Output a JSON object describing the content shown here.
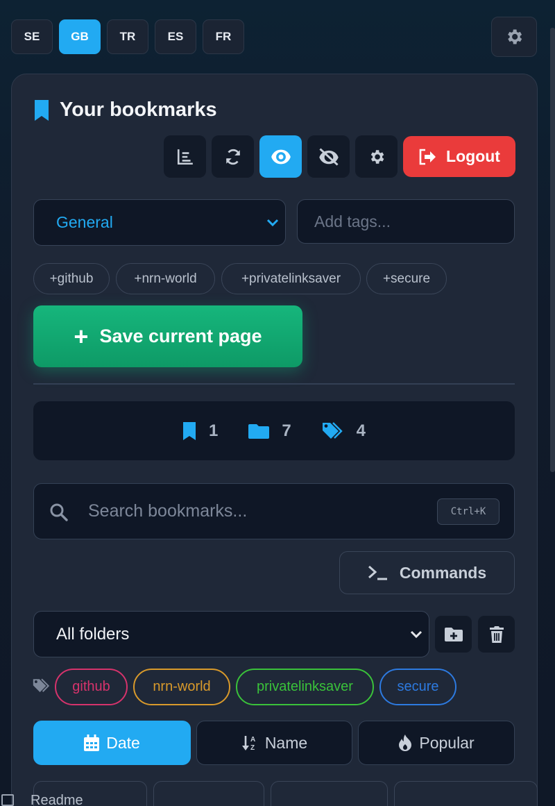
{
  "languages": [
    {
      "code": "SE",
      "active": false
    },
    {
      "code": "GB",
      "active": true
    },
    {
      "code": "TR",
      "active": false
    },
    {
      "code": "ES",
      "active": false
    },
    {
      "code": "FR",
      "active": false
    }
  ],
  "header": {
    "title": "Your bookmarks",
    "logout_label": "Logout",
    "icons": [
      "chart-icon",
      "sync-icon",
      "eye-icon",
      "eye-slash-icon",
      "gear-icon"
    ]
  },
  "form": {
    "folder_selected": "General",
    "tags_placeholder": "Add tags...",
    "quick_tags": [
      "+github",
      "+nrn-world",
      "+privatelinksaver",
      "+secure"
    ],
    "save_label": "Save current page"
  },
  "stats": {
    "bookmarks": "1",
    "folders": "7",
    "tags": "4"
  },
  "search": {
    "placeholder": "Search bookmarks...",
    "shortcut": "Ctrl+K"
  },
  "commands_label": "Commands",
  "filter": {
    "folder_selected": "All folders",
    "tags": [
      {
        "label": "github",
        "color": "#d6336c"
      },
      {
        "label": "nrn-world",
        "color": "#d99a2b"
      },
      {
        "label": "privatelinksaver",
        "color": "#3ac23a"
      },
      {
        "label": "secure",
        "color": "#2d7ae0"
      }
    ]
  },
  "sort": {
    "date_label": "Date",
    "name_label": "Name",
    "popular_label": "Popular"
  },
  "footer": {
    "text": "Readme"
  },
  "colors": {
    "accent": "#22aaf2",
    "danger": "#ea3b3b",
    "success": "#10b981",
    "panel": "#1f2838",
    "field": "#0f1726"
  }
}
